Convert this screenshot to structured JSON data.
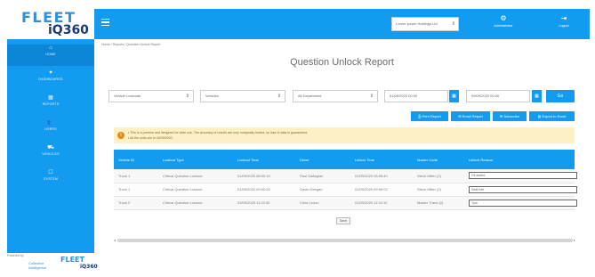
{
  "brand": {
    "logo_line1": "FLEET",
    "logo_line2": "iQ360"
  },
  "sidebar": {
    "items": [
      {
        "label": "HOME",
        "icon": "home-icon",
        "glyph": "⌂"
      },
      {
        "label": "DASHBOARDS",
        "icon": "heart-icon",
        "glyph": "♥"
      },
      {
        "label": "REPORTS",
        "icon": "reports-icon",
        "glyph": "▦"
      },
      {
        "label": "USERS",
        "icon": "users-icon",
        "glyph": "👥"
      },
      {
        "label": "VEHICLES",
        "icon": "vehicles-icon",
        "glyph": "⛟"
      },
      {
        "label": "SYSTEM",
        "icon": "system-icon",
        "glyph": "☐"
      }
    ]
  },
  "footer": {
    "powered_by": "Powered by",
    "company_line1": "Collective",
    "company_line2": "Intelligence",
    "logo_line1": "FLEET",
    "logo_line2": "iQ360"
  },
  "topbar": {
    "org_select": "Lorem Ipsum Holdings Ltd",
    "user_label": "Administrator",
    "logout_label": "Logout"
  },
  "breadcrumb": "Home  /  Reports  /  Question Unlock Report",
  "page": {
    "title": "Question Unlock Report"
  },
  "filters": {
    "lockout": "Vehicle Lockouts",
    "vehicle": "Vehicles",
    "department": "All Department",
    "date_from": "01/09/2020 00:00",
    "date_to": "09/09/2020 00:00",
    "go": "Go"
  },
  "actions": {
    "print": "Print Report",
    "email": "Email Report",
    "subscribe": "Subscribe",
    "excel": "Export to Excel"
  },
  "notice": {
    "line1": "• This is a preview and designed for wide use. The accuracy of results are only marginally tested; no loss of data is guaranteed.",
    "line2": "• All the units are in 04/09/2020"
  },
  "table": {
    "headers": [
      "Vehicle ID",
      "Lockout Type",
      "Lockout Time",
      "Driver",
      "Unlock Time",
      "Master Code",
      "Unlock Reason"
    ],
    "rows": [
      [
        "Truck 1",
        "Critical Question Lockout",
        "01/09/2020 08:00:10",
        "Paul Gallagher",
        "01/09/2020 08:05:40",
        "Steve Miller (2)",
        "Oil added"
      ],
      [
        "Truck 1",
        "Critical Question Lockout",
        "01/09/2020 09:00:20",
        "Gavin Deegan",
        "01/09/2020 09:09:02",
        "Steve Miller (2)",
        "Seat belt"
      ],
      [
        "Truck 2",
        "Critical Question Lockout",
        "03/09/2020 11:20:00",
        "Chris Lenon",
        "01/09/2020 11:34:10",
        "Master Trans (2)",
        "Tyre"
      ]
    ]
  },
  "save_label": "Save",
  "colors": {
    "primary": "#139cef",
    "notice_bg": "#fcf0c4",
    "warn": "#e08a18"
  }
}
